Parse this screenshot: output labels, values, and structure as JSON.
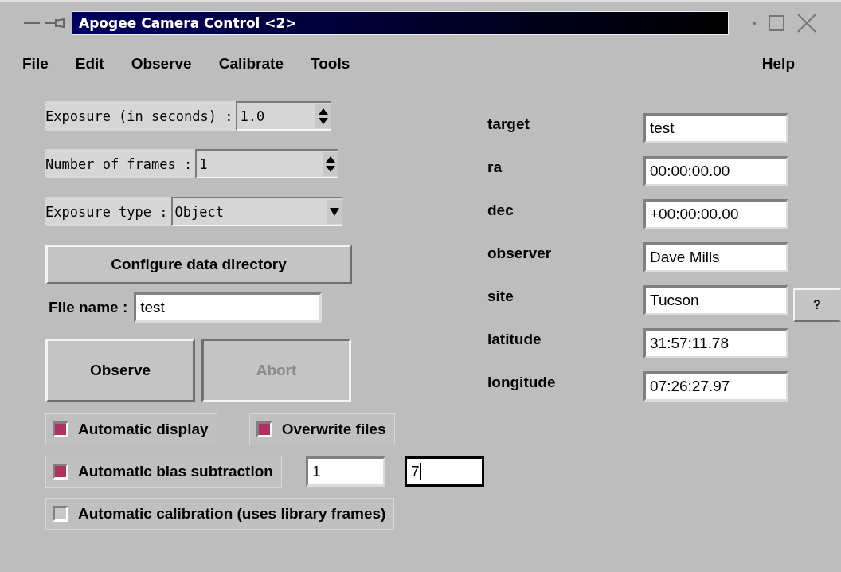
{
  "window": {
    "title": "Apogee Camera Control <2>"
  },
  "menu": [
    {
      "label": "File"
    },
    {
      "label": "Edit"
    },
    {
      "label": "Observe"
    },
    {
      "label": "Calibrate"
    },
    {
      "label": "Tools"
    },
    {
      "label": "Help",
      "kind": "right"
    }
  ],
  "settings": [
    {
      "label": "Exposure (in seconds) :",
      "value": "1.0",
      "kind": "spin"
    },
    {
      "label": "Number of frames :",
      "value": "1",
      "kind": "spin"
    },
    {
      "label": "Exposure type :",
      "value": "Object",
      "kind": "combo"
    }
  ],
  "configure_button": {
    "label": "Configure data directory"
  },
  "file_name": {
    "label": "File name :",
    "value": "test"
  },
  "actions": [
    {
      "label": "Observe",
      "disabled": false
    },
    {
      "label": "Abort",
      "disabled": true
    }
  ],
  "options": [
    {
      "label": "Automatic display",
      "checked": true,
      "kind": "check"
    },
    {
      "label": "Overwrite files",
      "checked": true,
      "kind": "check"
    },
    {
      "label": "Automatic bias subtraction",
      "checked": true,
      "kind": "check",
      "fields": [
        {
          "value": "1",
          "focused": false
        },
        {
          "value": "7",
          "focused": true
        }
      ]
    },
    {
      "label": "Automatic calibration (uses library frames)",
      "checked": false,
      "kind": "check"
    }
  ],
  "header_fields": [
    {
      "label": "target",
      "value": "test"
    },
    {
      "label": "ra",
      "value": "00:00:00.00"
    },
    {
      "label": "dec",
      "value": "+00:00:00.00"
    },
    {
      "label": "observer",
      "value": "Dave Mills"
    },
    {
      "label": "site",
      "value": "Tucson",
      "help": "?"
    },
    {
      "label": "latitude",
      "value": "31:57:11.78"
    },
    {
      "label": "longitude",
      "value": "07:26:27.97"
    }
  ]
}
